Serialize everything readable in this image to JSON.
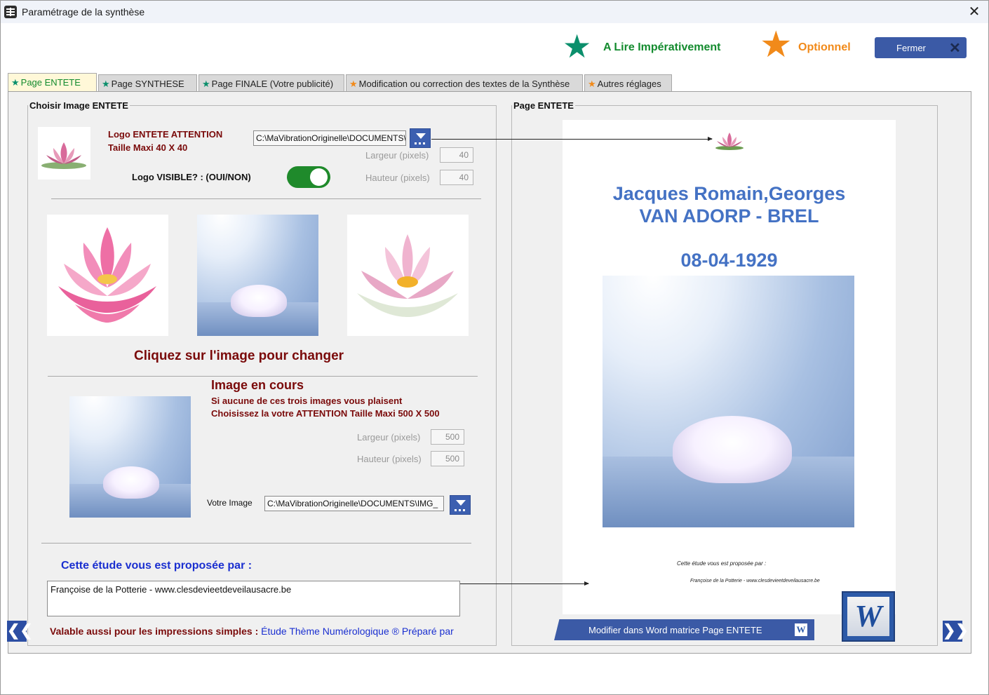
{
  "window": {
    "title": "Paramétrage de la synthèse",
    "close_glyph": "✕"
  },
  "header": {
    "mandatory_label": "A Lire Impérativement",
    "optional_label": "Optionnel",
    "close_button_label": "Fermer",
    "close_button_x": "✕",
    "colors": {
      "mandatory": "#0b8f6c",
      "optional": "#f18a1a"
    }
  },
  "tabs": [
    {
      "label": "Page ENTETE",
      "star": "green",
      "active": true
    },
    {
      "label": "Page SYNTHESE",
      "star": "green"
    },
    {
      "label": "Page FINALE (Votre publicité)",
      "star": "green"
    },
    {
      "label": "Modification ou correction des textes de la Synthèse",
      "star": "orange"
    },
    {
      "label": "Autres réglages",
      "star": "orange"
    }
  ],
  "left": {
    "legend": "Choisir Image ENTETE",
    "logo_note_line1": "Logo ENTETE  ATTENTION",
    "logo_note_line2": "Taille Maxi 40 X 40",
    "logo_path": "C:\\MaVibrationOriginelle\\DOCUMENTS\\",
    "logo_width_label": "Largeur (pixels)",
    "logo_width_value": "40",
    "logo_height_label": "Hauteur (pixels)",
    "logo_height_value": "40",
    "logo_visible_label": "Logo VISIBLE? : (OUI/NON)",
    "logo_visible": true,
    "change_hint": "Cliquez sur l'image pour changer",
    "current_title": "Image en cours",
    "current_note1": "Si aucune de ces trois images vous plaisent",
    "current_note2": "Choisissez la votre ATTENTION Taille Maxi 500 X 500",
    "img_width_label": "Largeur (pixels)",
    "img_width_value": "500",
    "img_height_label": "Hauteur (pixels)",
    "img_height_value": "500",
    "votre_image_label": "Votre Image",
    "votre_image_path": "C:\\MaVibrationOriginelle\\DOCUMENTS\\IMG_",
    "proposed_by_label": "Cette étude vous est proposée par :",
    "proposed_by_value": "Françoise de la Potterie - www.clesdevieetdeveilausacre.be",
    "valid_label": "Valable aussi pour les impressions simples : ",
    "valid_value": "Étude Thème Numérologique ® Préparé par",
    "nav_prev": "❮❮"
  },
  "right": {
    "legend": "Page ENTETE",
    "preview_name_line1": "Jacques Romain,Georges",
    "preview_name_line2": "VAN ADORP - BREL",
    "preview_date": "08-04-1929",
    "preview_proposed": "Cette  étude  vous  est  proposée  par  :",
    "preview_author": "Françoise de la Potterie - www.clesdevieetdeveilausacre.be",
    "word_button_label": "Modifier dans Word matrice Page ENTETE",
    "word_letter": "W",
    "nav_next": "❯❯"
  }
}
